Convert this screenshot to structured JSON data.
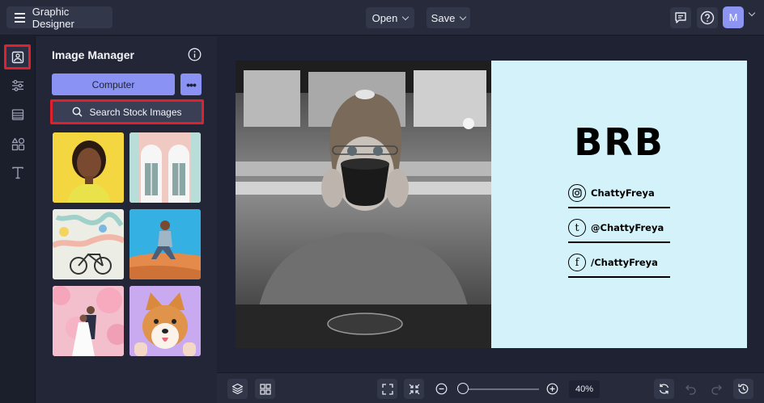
{
  "header": {
    "app_title": "Graphic Designer",
    "open_label": "Open",
    "save_label": "Save",
    "user_initial": "M"
  },
  "rail": {
    "items": [
      "images-icon",
      "adjustments-icon",
      "background-icon",
      "elements-icon",
      "text-icon"
    ],
    "active": "images-icon"
  },
  "panel": {
    "title": "Image Manager",
    "computer_label": "Computer",
    "more_label": "•••",
    "search_label": "Search Stock Images",
    "thumbnails": [
      "woman-yellow-background",
      "pastel-doors",
      "bicycle-mural",
      "man-sitting-desert",
      "wedding-couple-blossoms",
      "shiba-dog-purple"
    ]
  },
  "card": {
    "headline": "BRB",
    "socials": [
      {
        "icon": "instagram-icon",
        "glyph": "◎",
        "handle": "ChattyFreya"
      },
      {
        "icon": "tumblr-icon",
        "glyph": "t",
        "handle": "@ChattyFreya"
      },
      {
        "icon": "facebook-icon",
        "glyph": "f",
        "handle": "/ChattyFreya"
      }
    ],
    "background_color": "#d3f2fa"
  },
  "bottom": {
    "zoom_percent": "40%",
    "zoom_level": 0.0
  },
  "colors": {
    "accent": "#8a93f4",
    "highlight_box": "#e0202a",
    "background": "#1e2130"
  }
}
